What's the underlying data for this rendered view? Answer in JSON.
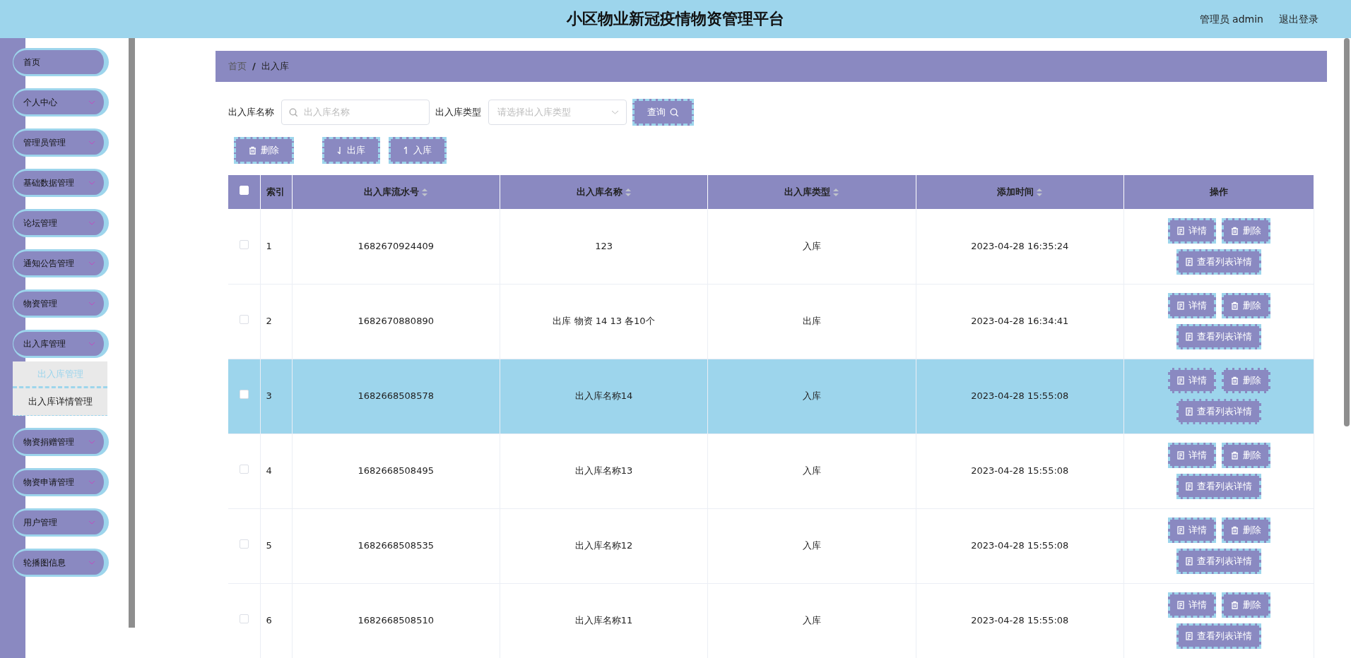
{
  "header": {
    "title": "小区物业新冠疫情物资管理平台",
    "user": "管理员 admin",
    "logout": "退出登录"
  },
  "sidebar": {
    "items": [
      {
        "label": "首页",
        "kind": "link"
      },
      {
        "label": "个人中心",
        "kind": "menu"
      },
      {
        "label": "管理员管理",
        "kind": "menu"
      },
      {
        "label": "基础数据管理",
        "kind": "menu"
      },
      {
        "label": "论坛管理",
        "kind": "menu"
      },
      {
        "label": "通知公告管理",
        "kind": "menu"
      },
      {
        "label": "物资管理",
        "kind": "menu"
      },
      {
        "label": "出入库管理",
        "kind": "menu",
        "children": [
          {
            "label": "出入库管理",
            "selected": true
          },
          {
            "label": "出入库详情管理",
            "selected": false
          }
        ]
      },
      {
        "label": "物资捐赠管理",
        "kind": "menu"
      },
      {
        "label": "物资申请管理",
        "kind": "menu"
      },
      {
        "label": "用户管理",
        "kind": "menu"
      },
      {
        "label": "轮播图信息",
        "kind": "menu"
      }
    ]
  },
  "breadcrumb": {
    "items": [
      "首页",
      "出入库"
    ],
    "separator": "/"
  },
  "search": {
    "fields": [
      {
        "label": "出入库名称",
        "placeholder": "出入库名称",
        "kind": "text"
      },
      {
        "label": "出入库类型",
        "placeholder": "请选择出入库类型",
        "kind": "select"
      }
    ],
    "button": "查询"
  },
  "toolbar": [
    {
      "label": "删除"
    },
    {
      "label": "出库"
    },
    {
      "label": "入库"
    }
  ],
  "table": {
    "select_all": {
      "checked": false
    },
    "columns": [
      {
        "label": "索引",
        "sortable": false
      },
      {
        "label": "出入库流水号",
        "sortable": true
      },
      {
        "label": "出入库名称",
        "sortable": true
      },
      {
        "label": "出入库类型",
        "sortable": true
      },
      {
        "label": "添加时间",
        "sortable": true
      },
      {
        "label": "操作",
        "sortable": false
      }
    ],
    "rows": [
      {
        "selected": false,
        "checked": false,
        "cells": [
          "1",
          "1682670924409",
          "123",
          "入库",
          "2023-04-28 16:35:24"
        ],
        "actions": [
          "详情",
          "删除",
          "查看列表详情"
        ]
      },
      {
        "selected": false,
        "checked": false,
        "cells": [
          "2",
          "1682670880890",
          "出库 物资 14 13 各10个",
          "出库",
          "2023-04-28 16:34:41"
        ],
        "actions": [
          "详情",
          "删除",
          "查看列表详情"
        ]
      },
      {
        "selected": true,
        "checked": false,
        "cells": [
          "3",
          "1682668508578",
          "出入库名称14",
          "入库",
          "2023-04-28 15:55:08"
        ],
        "actions": [
          "详情",
          "删除",
          "查看列表详情"
        ]
      },
      {
        "selected": false,
        "checked": false,
        "cells": [
          "4",
          "1682668508495",
          "出入库名称13",
          "入库",
          "2023-04-28 15:55:08"
        ],
        "actions": [
          "详情",
          "删除",
          "查看列表详情"
        ]
      },
      {
        "selected": false,
        "checked": false,
        "cells": [
          "5",
          "1682668508535",
          "出入库名称12",
          "入库",
          "2023-04-28 15:55:08"
        ],
        "actions": [
          "详情",
          "删除",
          "查看列表详情"
        ]
      },
      {
        "selected": false,
        "checked": false,
        "cells": [
          "6",
          "1682668508510",
          "出入库名称11",
          "入库",
          "2023-04-28 15:55:08"
        ],
        "actions": [
          "详情",
          "删除",
          "查看列表详情"
        ]
      }
    ]
  }
}
